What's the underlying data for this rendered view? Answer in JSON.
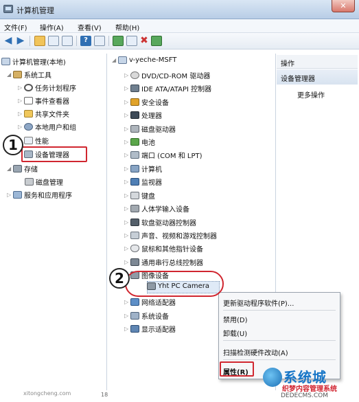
{
  "window": {
    "title": "计算机管理",
    "close_label": "✕"
  },
  "menu": [
    "文件(F)",
    "操作(A)",
    "查看(V)",
    "帮助(H)"
  ],
  "left_tree": {
    "root": "计算机管理(本地)",
    "system_tools": "系统工具",
    "task_scheduler": "任务计划程序",
    "event_viewer": "事件查看器",
    "shared_folders": "共享文件夹",
    "local_users": "本地用户和组",
    "performance": "性能",
    "device_manager": "设备管理器",
    "storage": "存储",
    "disk_management": "磁盘管理",
    "services_apps": "服务和应用程序"
  },
  "device_tree": {
    "root": "v-yeche-MSFT",
    "items": [
      "DVD/CD-ROM 驱动器",
      "IDE ATA/ATAPI 控制器",
      "安全设备",
      "处理器",
      "磁盘驱动器",
      "电池",
      "端口 (COM 和 LPT)",
      "计算机",
      "监视器",
      "键盘",
      "人体学输入设备",
      "软盘驱动器控制器",
      "声音、视频和游戏控制器",
      "鼠标和其他指针设备",
      "通用串行总线控制器",
      "图像设备"
    ],
    "camera": "Yht PC Camera",
    "after": [
      "网络适配器",
      "系统设备",
      "显示适配器"
    ]
  },
  "actions": {
    "header": "操作",
    "section": "设备管理器",
    "more": "更多操作"
  },
  "context_menu": {
    "update_driver": "更新驱动程序软件(P)...",
    "disable": "禁用(D)",
    "uninstall": "卸载(U)",
    "scan": "扫描检测硬件改动(A)",
    "properties": "属性(R)"
  },
  "callouts": [
    "1",
    "2"
  ],
  "watermark": {
    "title": "系统城",
    "subtitle": "织梦内容管理系统",
    "url": "DEDECMS.COM",
    "under": "xitongcheng.com"
  },
  "footer_mark": "18"
}
